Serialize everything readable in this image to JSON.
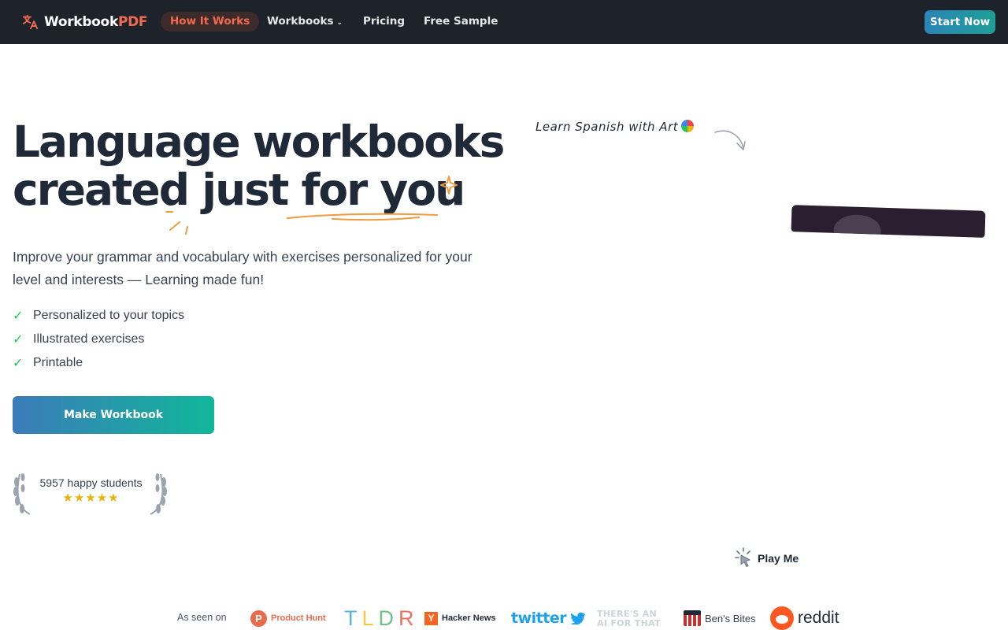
{
  "nav": {
    "logo_main": "Workbook",
    "logo_accent": "PDF",
    "links": [
      {
        "label": "How It Works",
        "active": true
      },
      {
        "label": "Workbooks",
        "has_dropdown": true
      },
      {
        "label": "Pricing"
      },
      {
        "label": "Free Sample"
      }
    ],
    "cta": "Start Now"
  },
  "hero": {
    "headline_line1": "Language workbooks",
    "headline_line2": "created just for you",
    "subtitle": "Improve your grammar and vocabulary with exercises personalized for your level and interests — Learning made fun!",
    "features": [
      "Personalized to your topics",
      "Illustrated exercises",
      "Printable"
    ],
    "button": "Make Workbook",
    "students": "5957 happy students",
    "stars": "★★★★★",
    "rating_stars": 5
  },
  "media": {
    "annotation": "Learn Spanish with Art",
    "play_label": "Play Me"
  },
  "press": {
    "label": "As seen on",
    "product_hunt_letter": "P",
    "product_hunt": "Product Hunt",
    "tldr": [
      "T",
      "L",
      "D",
      "R"
    ],
    "hacker_news_letter": "Y",
    "hacker_news": "Hacker News",
    "twitter": "twitter",
    "ai_line1": "There's an",
    "ai_line2": "AI for that",
    "bens_bites": "Ben's Bites",
    "reddit": "reddit"
  },
  "colors": {
    "nav_bg": "#1e222a",
    "accent": "#f26b4f",
    "gradient_start": "#3b7bb9",
    "gradient_end": "#10b79a",
    "check": "#22c55e",
    "star": "#eab308"
  }
}
